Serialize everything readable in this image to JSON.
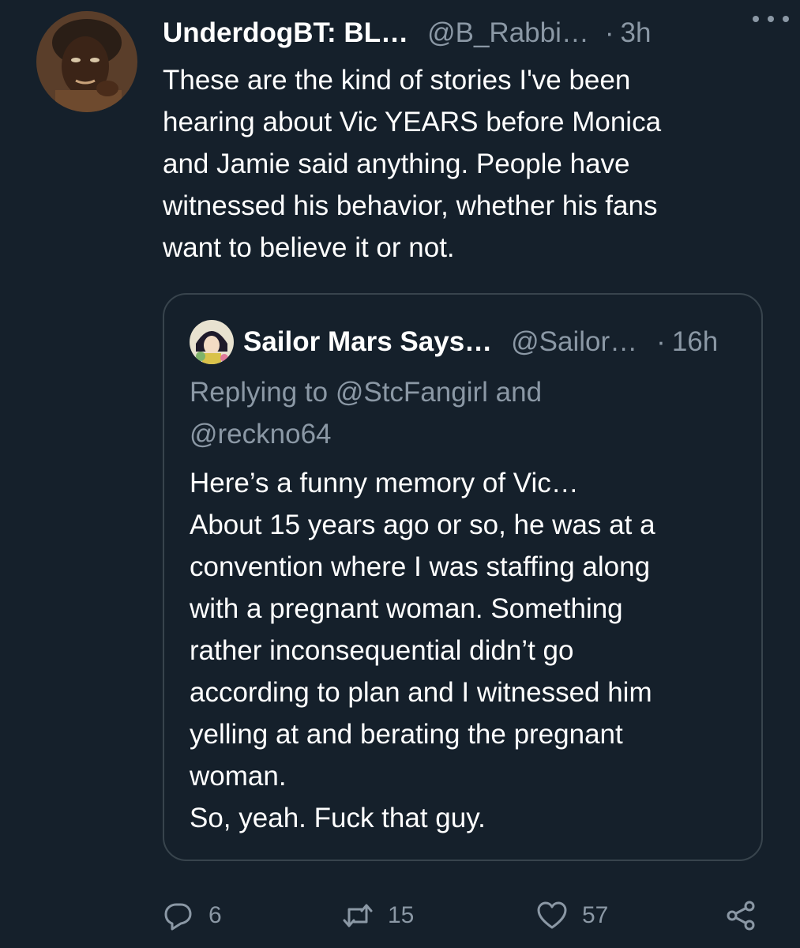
{
  "tweet": {
    "author": {
      "display_name": "UnderdogBT: BL…",
      "handle": "@B_Rabbi…",
      "separator": "·",
      "time": "3h",
      "avatar_icon": "profile-avatar"
    },
    "text": "These are the kind of stories I've been\nhearing about Vic YEARS before Monica\nand Jamie said anything. People have\nwitnessed his behavior, whether his fans\nwant to believe it or not.",
    "more_icon": "more-options-icon"
  },
  "quote": {
    "author": {
      "display_name": "Sailor Mars Says…",
      "handle": "@Sailor…",
      "separator": "·",
      "time": "16h",
      "avatar_icon": "profile-avatar"
    },
    "replying_to": "Replying to @StcFangirl and\n@reckno64",
    "text": "Here’s a funny memory of Vic…\nAbout 15 years ago or so, he was at a\nconvention where I was staffing along\nwith a pregnant woman. Something\nrather inconsequential didn’t go\naccording to plan and I witnessed him\nyelling at and berating the pregnant\nwoman.\nSo, yeah. Fuck that guy."
  },
  "actions": {
    "reply": {
      "icon": "reply-icon",
      "count": "6"
    },
    "retweet": {
      "icon": "retweet-icon",
      "count": "15"
    },
    "like": {
      "icon": "heart-icon",
      "count": "57"
    },
    "share": {
      "icon": "share-icon"
    }
  },
  "colors": {
    "background": "#15202b",
    "text_primary": "#ffffff",
    "text_secondary": "#8b98a5",
    "border": "#38444d"
  }
}
